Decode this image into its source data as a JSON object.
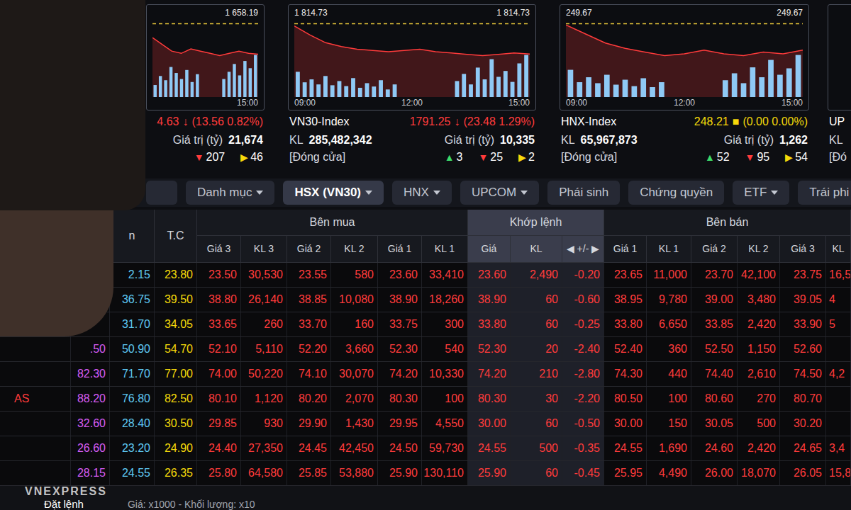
{
  "index_cards": [
    {
      "value": "4.63",
      "arrow": "↓",
      "change": "(13.56 0.82%)",
      "color": "#ff3b3b",
      "value_label": "Giá trị (tỷ)",
      "value_amount": "21,674",
      "counts": [
        {
          "symbol": "▼",
          "count": "207",
          "color": "#ff3b3b"
        },
        {
          "symbol": "▶",
          "count": "46",
          "color": "#f5d90a"
        }
      ],
      "chart": {
        "ref": 1658.19,
        "ref_labels": [
          "1 658.19"
        ],
        "times": [
          "15:00"
        ],
        "line": [
          1652,
          1649,
          1646,
          1645,
          1647,
          1646,
          1645,
          1644,
          1645,
          1646,
          1645,
          1644.63
        ],
        "volume": [
          20,
          35,
          28,
          50,
          40,
          30,
          45,
          25,
          38,
          0,
          0,
          0,
          0,
          30,
          42,
          55,
          36,
          60,
          48,
          70
        ]
      }
    },
    {
      "name": "VN30-Index",
      "value": "1791.25",
      "arrow": "↓",
      "change": "(23.48 1.29%)",
      "color": "#ff3b3b",
      "kl_label": "KL",
      "kl": "285,482,342",
      "value_label": "Giá trị (tỷ)",
      "value_amount": "10,335",
      "status": "[Đóng cửa]",
      "counts": [
        {
          "symbol": "▲",
          "count": "3",
          "color": "#3ddc6a"
        },
        {
          "symbol": "▼",
          "count": "25",
          "color": "#ff3b3b"
        },
        {
          "symbol": "▶",
          "count": "2",
          "color": "#f5d90a"
        }
      ],
      "chart": {
        "ref": 1814.73,
        "ref_labels": [
          "1 814.73",
          "1 814.73"
        ],
        "times": [
          "09:00",
          "12:00",
          "15:00"
        ],
        "line": [
          1813,
          1806,
          1800,
          1797,
          1795,
          1794,
          1793,
          1794,
          1795,
          1793,
          1792,
          1791,
          1790,
          1791,
          1792,
          1791.25
        ],
        "volume": [
          60,
          35,
          42,
          30,
          50,
          28,
          38,
          26,
          45,
          22,
          33,
          25,
          40,
          18,
          30,
          0,
          0,
          0,
          0,
          0,
          0,
          0,
          0,
          38,
          55,
          30,
          70,
          42,
          90,
          48,
          62,
          36,
          80,
          100
        ]
      }
    },
    {
      "name": "HNX-Index",
      "value": "248.21",
      "arrow": "■",
      "change": "(0.00 0.00%)",
      "color": "#f5d90a",
      "kl_label": "KL",
      "kl": "65,967,873",
      "value_label": "Giá trị (tỷ)",
      "value_amount": "1,262",
      "status": "[Đóng cửa]",
      "counts": [
        {
          "symbol": "▲",
          "count": "52",
          "color": "#3ddc6a"
        },
        {
          "symbol": "▼",
          "count": "95",
          "color": "#ff3b3b"
        },
        {
          "symbol": "▶",
          "count": "54",
          "color": "#f5d90a"
        }
      ],
      "chart": {
        "ref": 249.67,
        "ref_labels": [
          "249.67",
          "249.67"
        ],
        "times": [
          "09:00",
          "12:00",
          "15:00"
        ],
        "line": [
          249.6,
          249.1,
          248.6,
          248.3,
          248.1,
          247.9,
          248.0,
          248.2,
          248.0,
          247.9,
          248.1,
          248.0,
          248.21
        ],
        "volume": [
          55,
          30,
          40,
          28,
          45,
          25,
          35,
          22,
          38,
          20,
          30,
          0,
          0,
          0,
          0,
          0,
          0,
          34,
          48,
          28,
          60,
          40,
          75,
          45,
          58,
          85
        ]
      }
    },
    {
      "name": "UP",
      "kl_label": "KL",
      "status": "[Đó",
      "chart": {
        "ref_labels": [],
        "times": [],
        "line": [],
        "volume": []
      }
    }
  ],
  "tabs": [
    {
      "label": "Danh mục",
      "dropdown": true,
      "selected": false
    },
    {
      "label": "HSX (VN30)",
      "dropdown": true,
      "selected": true
    },
    {
      "label": "HNX",
      "dropdown": true,
      "selected": false
    },
    {
      "label": "UPCOM",
      "dropdown": true,
      "selected": false
    },
    {
      "label": "Phái sinh",
      "dropdown": false,
      "selected": false
    },
    {
      "label": "Chứng quyền",
      "dropdown": false,
      "selected": false
    },
    {
      "label": "ETF",
      "dropdown": true,
      "selected": false
    },
    {
      "label": "Trái phi",
      "dropdown": false,
      "selected": false
    }
  ],
  "table": {
    "groups": [
      {
        "label": "Bên mua",
        "kind": "buy"
      },
      {
        "label": "Khớp lệnh",
        "kind": "match"
      },
      {
        "label": "Bên bán",
        "kind": "sell"
      }
    ],
    "columns": [
      {
        "label": "",
        "kind": "symbol",
        "color": "#ff3b3b"
      },
      {
        "label": "",
        "kind": "ceiling",
        "color": "#d65cf5"
      },
      {
        "label": "n",
        "kind": "floor",
        "color": "#5ec8f2"
      },
      {
        "label": "T.C",
        "kind": "ref",
        "color": "#f5d90a"
      },
      {
        "label": "Giá 3",
        "kind": "buy",
        "color": "#ff3b3b"
      },
      {
        "label": "KL 3",
        "kind": "buy",
        "color": "#ff3b3b"
      },
      {
        "label": "Giá 2",
        "kind": "buy",
        "color": "#ff3b3b"
      },
      {
        "label": "KL 2",
        "kind": "buy",
        "color": "#ff3b3b"
      },
      {
        "label": "Giá 1",
        "kind": "buy",
        "color": "#ff3b3b"
      },
      {
        "label": "KL 1",
        "kind": "buy",
        "color": "#ff3b3b"
      },
      {
        "label": "Giá",
        "kind": "match",
        "color": "#ff3b3b"
      },
      {
        "label": "KL",
        "kind": "match",
        "color": "#ff3b3b"
      },
      {
        "label": "◀ +/- ▶",
        "kind": "match",
        "color": "#ff3b3b"
      },
      {
        "label": "Giá 1",
        "kind": "sell",
        "color": "#ff3b3b"
      },
      {
        "label": "KL 1",
        "kind": "sell",
        "color": "#ff3b3b"
      },
      {
        "label": "Giá 2",
        "kind": "sell",
        "color": "#ff3b3b"
      },
      {
        "label": "KL 2",
        "kind": "sell",
        "color": "#ff3b3b"
      },
      {
        "label": "Giá 3",
        "kind": "sell",
        "color": "#ff3b3b"
      },
      {
        "label": "KL",
        "kind": "sell",
        "color": "#ff3b3b"
      }
    ],
    "rows": [
      [
        "",
        "",
        "2.15",
        "23.80",
        "23.50",
        "30,530",
        "23.55",
        "580",
        "23.60",
        "33,410",
        "23.60",
        "2,490",
        "-0.20",
        "23.65",
        "11,000",
        "23.70",
        "42,100",
        "23.75",
        "16,5"
      ],
      [
        "",
        "",
        "36.75",
        "39.50",
        "38.80",
        "26,140",
        "38.85",
        "10,080",
        "38.90",
        "18,260",
        "38.90",
        "60",
        "-0.60",
        "38.95",
        "9,780",
        "39.00",
        "3,480",
        "39.05",
        "4"
      ],
      [
        "",
        "",
        "31.70",
        "34.05",
        "33.65",
        "260",
        "33.70",
        "160",
        "33.75",
        "300",
        "33.80",
        "60",
        "-0.25",
        "33.80",
        "6,650",
        "33.85",
        "2,420",
        "33.90",
        "5"
      ],
      [
        "",
        ".50",
        "50.90",
        "54.70",
        "52.10",
        "5,110",
        "52.20",
        "3,660",
        "52.30",
        "540",
        "52.30",
        "20",
        "-2.40",
        "52.40",
        "360",
        "52.50",
        "1,150",
        "52.60",
        ""
      ],
      [
        "",
        "82.30",
        "71.70",
        "77.00",
        "74.00",
        "50,220",
        "74.10",
        "30,070",
        "74.20",
        "10,330",
        "74.20",
        "210",
        "-2.80",
        "74.30",
        "440",
        "74.40",
        "2,610",
        "74.50",
        "4,2"
      ],
      [
        "AS",
        "88.20",
        "76.80",
        "82.50",
        "80.10",
        "1,120",
        "80.20",
        "2,070",
        "80.30",
        "100",
        "80.30",
        "30",
        "-2.20",
        "80.50",
        "100",
        "80.60",
        "270",
        "80.70",
        ""
      ],
      [
        "",
        "32.60",
        "28.40",
        "30.50",
        "29.85",
        "930",
        "29.90",
        "1,430",
        "29.95",
        "4,550",
        "30.00",
        "60",
        "-0.50",
        "30.00",
        "150",
        "30.05",
        "500",
        "30.20",
        ""
      ],
      [
        "",
        "26.60",
        "23.20",
        "24.90",
        "24.40",
        "27,350",
        "24.45",
        "42,450",
        "24.50",
        "59,730",
        "24.55",
        "500",
        "-0.35",
        "24.55",
        "1,690",
        "24.60",
        "2,420",
        "24.65",
        "3,4"
      ],
      [
        "",
        "28.15",
        "24.55",
        "26.35",
        "25.80",
        "64,580",
        "25.85",
        "53,880",
        "25.90",
        "130,110",
        "25.90",
        "60",
        "-0.45",
        "25.95",
        "4,490",
        "26.00",
        "18,070",
        "26.05",
        "15,8"
      ]
    ]
  },
  "footer": {
    "watermark": "VNEXPRESS",
    "order_button": "Đặt lệnh",
    "unit_note": "Giá: x1000 - Khối lượng: x10"
  }
}
